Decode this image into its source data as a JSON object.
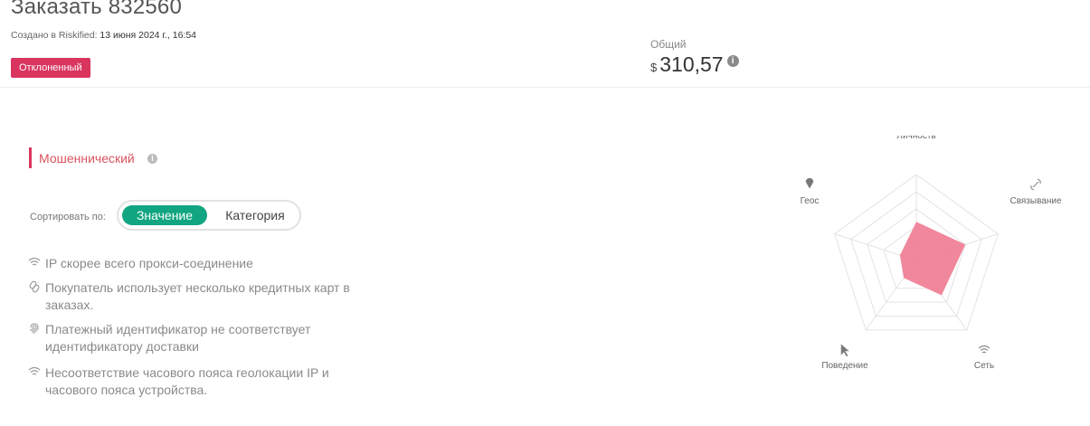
{
  "header": {
    "title": "Заказать 832560",
    "created_label": "Создано в Riskified:",
    "created_value": "13 июня 2024 г., 16:54",
    "status_badge": "Отклоненный",
    "total_label": "Общий",
    "total_currency": "$",
    "total_amount": "310,57"
  },
  "analysis": {
    "category_label": "Мошеннический",
    "sort_label": "Сортировать по:",
    "sort_options": [
      "Значение",
      "Категория"
    ],
    "sort_selected": "Значение",
    "reasons": [
      {
        "icon": "wifi-icon",
        "text": "IP скорее всего прокси-соединение"
      },
      {
        "icon": "link-icon",
        "text": "Покупатель использует несколько кредитных карт в заказах."
      },
      {
        "icon": "fingerprint-icon",
        "text": "Платежный идентификатор не соответствует идентификатору доставки"
      },
      {
        "icon": "wifi-icon",
        "text": "Несоответствие часового пояса геолокации IP и часового пояса устройства."
      }
    ]
  },
  "radar": {
    "axes": [
      {
        "label": "Личность",
        "icon": "fingerprint-icon",
        "value": 0.45
      },
      {
        "label": "Связывание",
        "icon": "link-icon",
        "value": 0.6
      },
      {
        "label": "Сеть",
        "icon": "wifi-icon",
        "value": 0.5
      },
      {
        "label": "Поведение",
        "icon": "cursor-icon",
        "value": 0.25
      },
      {
        "label": "Геос",
        "icon": "location-pin-icon",
        "value": 0.2
      }
    ],
    "fill_color": "#f07a91",
    "grid_color": "#e3e3e3"
  },
  "colors": {
    "badge": "#d9355f",
    "toggle_active": "#12a582",
    "fraud_accent": "#d9355f"
  }
}
